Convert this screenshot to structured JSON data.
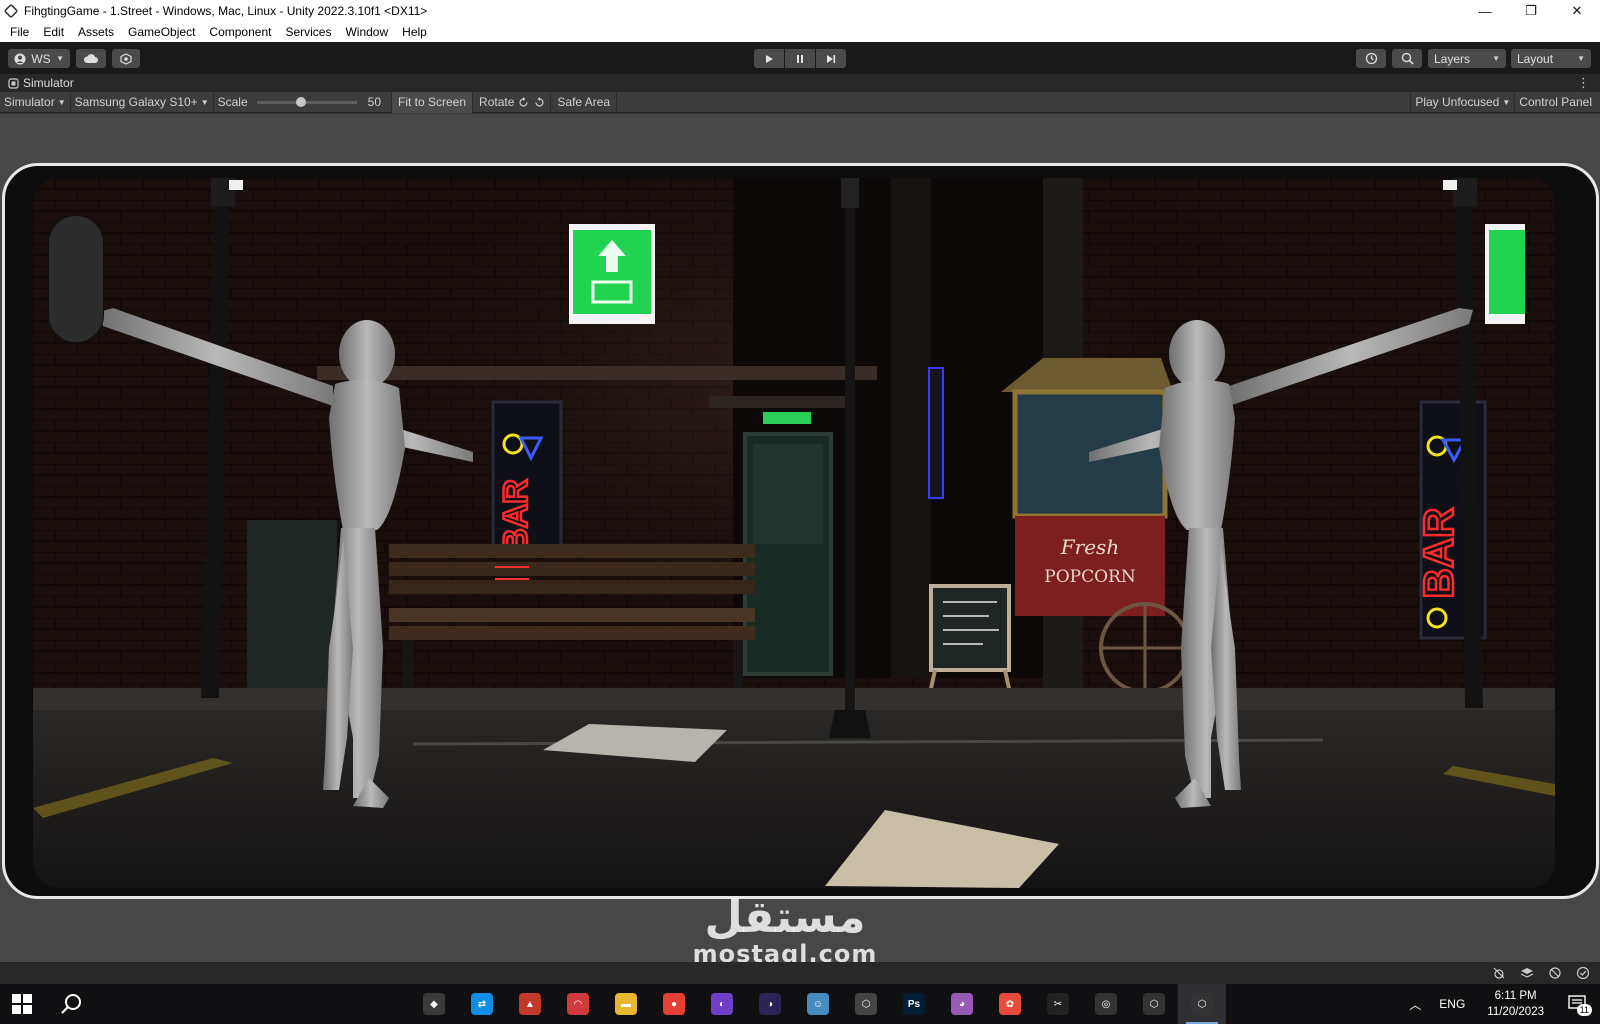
{
  "window": {
    "title": "FihgtingGame - 1.Street - Windows, Mac, Linux - Unity 2022.3.10f1 <DX11>",
    "minimize": "—",
    "maximize": "❐",
    "close": "✕"
  },
  "menu": [
    "File",
    "Edit",
    "Assets",
    "GameObject",
    "Component",
    "Services",
    "Window",
    "Help"
  ],
  "toolbar": {
    "account_label": "WS",
    "layers_label": "Layers",
    "layout_label": "Layout"
  },
  "simulator_tab": {
    "label": "Simulator",
    "menu_glyph": "⋮"
  },
  "simulator_toolbar": {
    "mode": "Simulator",
    "device": "Samsung Galaxy S10+",
    "scale_label": "Scale",
    "scale_value": "50",
    "scale_fraction": 0.44,
    "fit_to_screen": "Fit to Screen",
    "rotate": "Rotate",
    "safe_area": "Safe Area",
    "play_mode": "Play Unfocused",
    "control_panel": "Control Panel"
  },
  "game_view": {
    "scene": "dark alley street at night with two grey mannequin characters in T-pose, brick wall, neon BAR signs, popcorn cart, bench, street lamps",
    "signs": {
      "bar": "BAR",
      "popcorn_top": "Fresh",
      "popcorn_bottom": "POPCORN"
    }
  },
  "watermark": {
    "arabic": "مستقل",
    "latin": "mostaql.com"
  },
  "taskbar": {
    "apps": [
      {
        "name": "inkscape",
        "color": "#3a3a3a",
        "glyph": "◆"
      },
      {
        "name": "teamviewer",
        "color": "#0e8ee9",
        "glyph": "⇄"
      },
      {
        "name": "app-red",
        "color": "#c0392b",
        "glyph": "▲"
      },
      {
        "name": "app-arc",
        "color": "#d23b3b",
        "glyph": "◠"
      },
      {
        "name": "file-explorer",
        "color": "#e8b730",
        "glyph": "▬"
      },
      {
        "name": "chrome",
        "color": "#e44134",
        "glyph": "●"
      },
      {
        "name": "github",
        "color": "#6e40c9",
        "glyph": "◐"
      },
      {
        "name": "eclipse",
        "color": "#2c2255",
        "glyph": "◑"
      },
      {
        "name": "godot",
        "color": "#478cbf",
        "glyph": "☺"
      },
      {
        "name": "unity-hub",
        "color": "#444",
        "glyph": "⬡"
      },
      {
        "name": "photoshop",
        "color": "#001e36",
        "glyph": "Ps"
      },
      {
        "name": "app-color",
        "color": "#9b59b6",
        "glyph": "◕"
      },
      {
        "name": "app-wheel",
        "color": "#e74c3c",
        "glyph": "✿"
      },
      {
        "name": "capcut",
        "color": "#222",
        "glyph": "✂"
      },
      {
        "name": "obs",
        "color": "#333",
        "glyph": "◎"
      },
      {
        "name": "unity-2",
        "color": "#333",
        "glyph": "⬡"
      },
      {
        "name": "unity-editor",
        "color": "#333",
        "glyph": "⬡"
      }
    ],
    "lang": "ENG",
    "time": "6:11 PM",
    "date": "11/20/2023",
    "notifications": "11"
  }
}
